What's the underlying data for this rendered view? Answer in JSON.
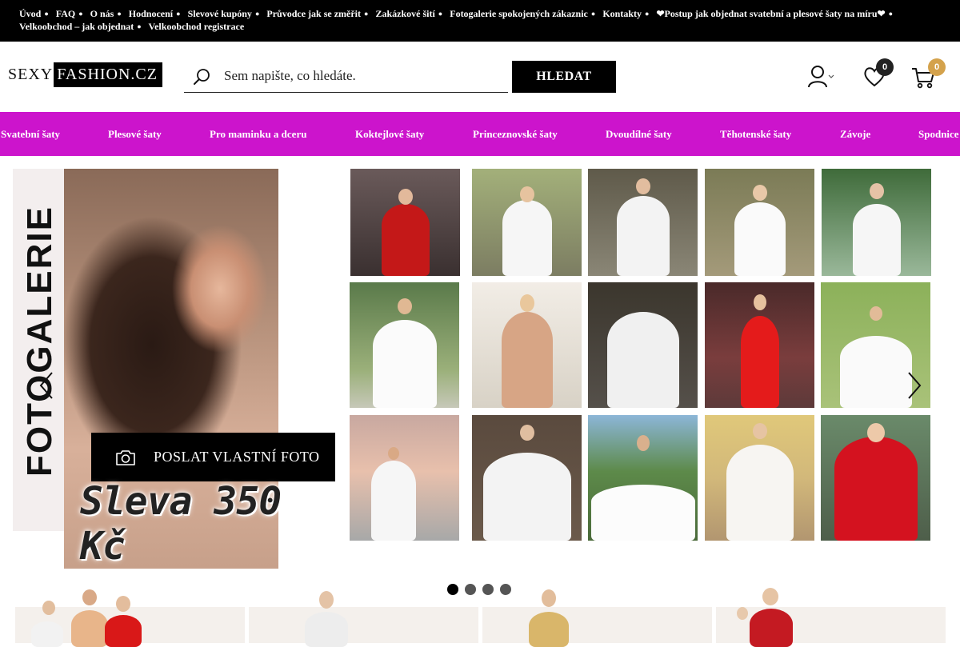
{
  "top_links": [
    {
      "label": "Úvod"
    },
    {
      "label": "FAQ"
    },
    {
      "label": "O nás"
    },
    {
      "label": "Hodnocení"
    },
    {
      "label": "Slevové kupóny"
    },
    {
      "label": "Průvodce jak se změřit"
    },
    {
      "label": "Zakázkové šití"
    },
    {
      "label": "Fotogalerie spokojených zákaznic"
    },
    {
      "label": "Kontakty"
    },
    {
      "label": "❤Postup jak objednat svatební a plesové šaty na míru❤"
    },
    {
      "label": "Velkoobchod – jak objednat"
    },
    {
      "label": "Velkoobchod registrace"
    }
  ],
  "header": {
    "logo_part1": "SEXY",
    "logo_part2": "FASHION.CZ",
    "search_placeholder": "Sem napište, co hledáte.",
    "search_button": "HLEDAT",
    "wishlist_count": "0",
    "cart_count": "0"
  },
  "categories": [
    {
      "label": "Svatební šaty"
    },
    {
      "label": "Plesové šaty"
    },
    {
      "label": "Pro maminku a dceru"
    },
    {
      "label": "Koktejlové šaty"
    },
    {
      "label": "Princeznovské šaty"
    },
    {
      "label": "Dvoudílné šaty"
    },
    {
      "label": "Těhotenské šaty"
    },
    {
      "label": "Závoje"
    },
    {
      "label": "Spodnice"
    }
  ],
  "hero": {
    "vertical_title": "FOTOGALERIE",
    "send_photo_button": "POSLAT VLASTNÍ FOTO",
    "discount_text": "Sleva 350 Kč"
  },
  "carousel": {
    "slides": 4,
    "active": 0
  },
  "colors": {
    "nav_bg": "#cc14cc",
    "top_bar_bg": "#000000",
    "wishlist_badge": "#222222",
    "cart_badge": "#d4a24c"
  }
}
